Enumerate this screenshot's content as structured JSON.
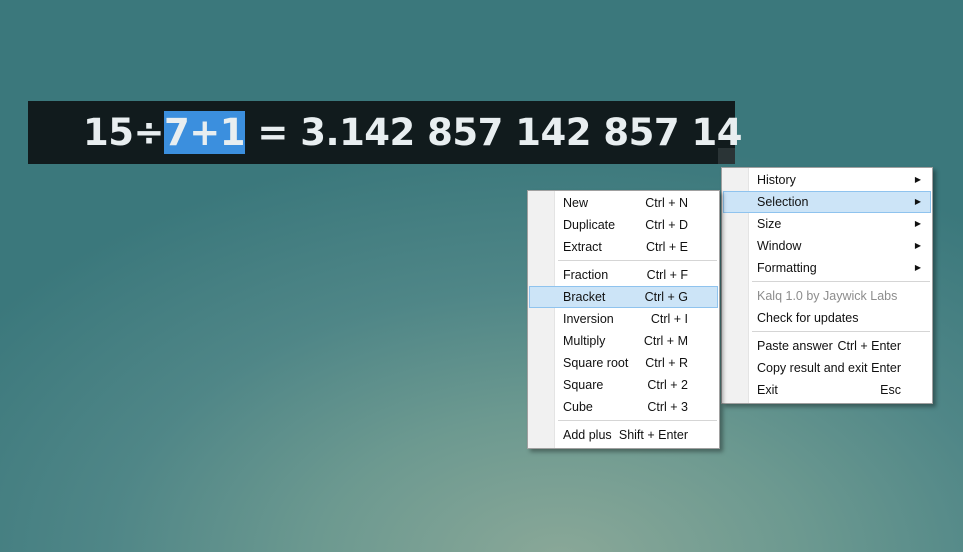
{
  "calculator": {
    "expr_before": "15÷",
    "expr_selected": "7+1",
    "expr_after": " = 3.142 857 142 857 14"
  },
  "main_menu": {
    "history": "History",
    "selection": "Selection",
    "size": "Size",
    "window": "Window",
    "formatting": "Formatting",
    "about": "Kalq 1.0 by Jaywick Labs",
    "check_updates": "Check for updates",
    "paste_answer": {
      "label": "Paste answer",
      "shortcut": "Ctrl + Enter"
    },
    "copy_exit": {
      "label": "Copy result and exit",
      "shortcut": "Enter"
    },
    "exit": {
      "label": "Exit",
      "shortcut": "Esc"
    },
    "arrow": "▶"
  },
  "selection_menu": {
    "items": [
      {
        "label": "New",
        "shortcut": "Ctrl + N"
      },
      {
        "label": "Duplicate",
        "shortcut": "Ctrl + D"
      },
      {
        "label": "Extract",
        "shortcut": "Ctrl + E"
      },
      {
        "label": "Fraction",
        "shortcut": "Ctrl + F"
      },
      {
        "label": "Bracket",
        "shortcut": "Ctrl + G"
      },
      {
        "label": "Inversion",
        "shortcut": "Ctrl + I"
      },
      {
        "label": "Multiply",
        "shortcut": "Ctrl + M"
      },
      {
        "label": "Square root",
        "shortcut": "Ctrl + R"
      },
      {
        "label": "Square",
        "shortcut": "Ctrl + 2"
      },
      {
        "label": "Cube",
        "shortcut": "Ctrl + 3"
      },
      {
        "label": "Add plus",
        "shortcut": "Shift + Enter"
      }
    ]
  }
}
